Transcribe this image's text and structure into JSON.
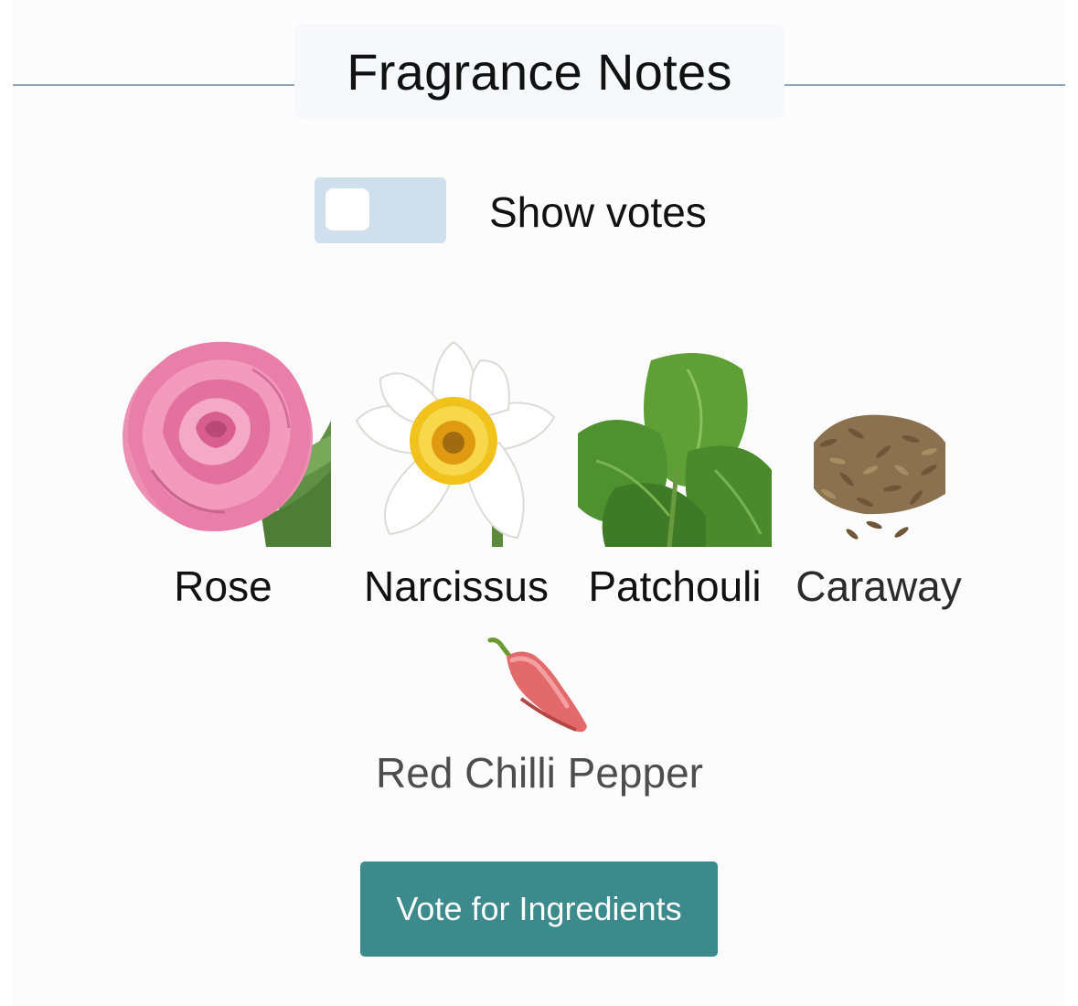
{
  "header": {
    "title": "Fragrance Notes"
  },
  "toggle": {
    "label": "Show votes",
    "on": false
  },
  "notes": [
    {
      "name": "Rose",
      "icon": "rose-icon"
    },
    {
      "name": "Narcissus",
      "icon": "narcissus-icon"
    },
    {
      "name": "Patchouli",
      "icon": "patchouli-icon"
    },
    {
      "name": "Caraway",
      "icon": "caraway-icon"
    },
    {
      "name": "Red Chilli Pepper",
      "icon": "red-chilli-pepper-icon"
    }
  ],
  "actions": {
    "vote_label": "Vote for Ingredients"
  },
  "colors": {
    "accent": "#3c8a8c",
    "toggle_track": "#d0dfee",
    "divider": "#8fa7bd",
    "title_bg": "#f6f8fb"
  }
}
